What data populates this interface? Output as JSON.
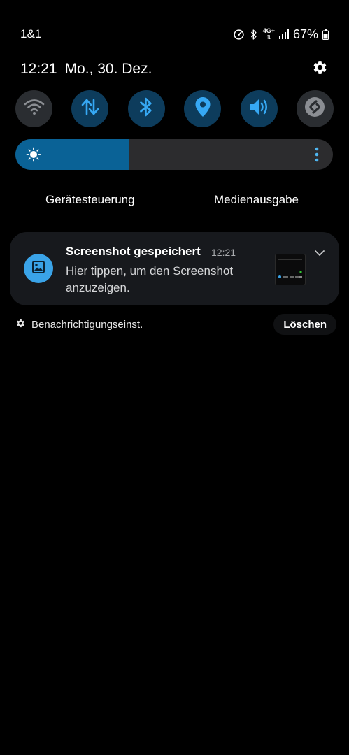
{
  "status_bar": {
    "carrier": "1&1",
    "network_type": "4G+",
    "battery_percent": "67%",
    "icons": [
      "data-saver-icon",
      "bluetooth-icon",
      "network-4g-icon",
      "signal-icon",
      "battery-icon"
    ]
  },
  "header": {
    "time": "12:21",
    "date": "Mo., 30. Dez.",
    "settings_icon": "gear-icon"
  },
  "quick_settings": {
    "tiles": [
      {
        "name": "wifi",
        "icon": "wifi-icon",
        "state": "off"
      },
      {
        "name": "mobile-data",
        "icon": "mobile-data-icon",
        "state": "on"
      },
      {
        "name": "bluetooth",
        "icon": "bluetooth-icon",
        "state": "on"
      },
      {
        "name": "location",
        "icon": "location-icon",
        "state": "on"
      },
      {
        "name": "sound",
        "icon": "sound-icon",
        "state": "on"
      },
      {
        "name": "shazam",
        "icon": "shazam-icon",
        "state": "off"
      }
    ],
    "accent_on_bg": "#0d3c5c",
    "accent_on_icon": "#36a8f4"
  },
  "brightness": {
    "level": 0.36,
    "fill_color": "#0a6296"
  },
  "media": {
    "device_control_label": "Gerätesteuerung",
    "media_output_label": "Medienausgabe"
  },
  "notification": {
    "title": "Screenshot gespeichert",
    "time": "12:21",
    "body": "Hier tippen, um den Screenshot anzuzeigen.",
    "app_icon_color": "#3aa3e8"
  },
  "footer": {
    "settings_label": "Benachrichtigungseinst.",
    "clear_label": "Löschen"
  }
}
